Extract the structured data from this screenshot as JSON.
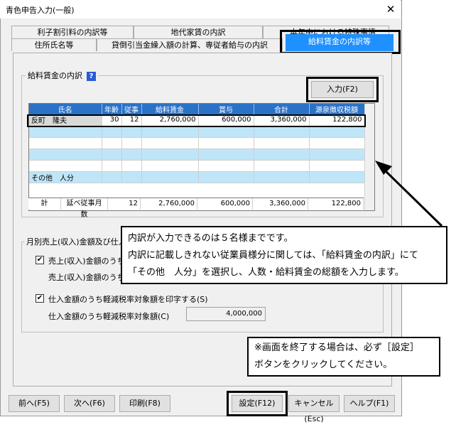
{
  "window": {
    "title": "青色申告入力(一般)",
    "close_glyph": "✕"
  },
  "tabs_row1": [
    {
      "label": "利子割引料の内訳等"
    },
    {
      "label": "地代家賃の内訳"
    },
    {
      "label": "本年中における特殊事情"
    }
  ],
  "tabs_row2": [
    {
      "label": "住所氏名等"
    },
    {
      "label": "貸倒引当金繰入額の計算、専従者給与の内訳"
    },
    {
      "label": "給料賃金の内訳等"
    }
  ],
  "wages_group": {
    "title": "給料賃金の内訳",
    "help_glyph": "?",
    "input_button": "入力(F2)"
  },
  "table": {
    "columns": [
      "氏名",
      "年齢",
      "従事",
      "給料賃金",
      "賞与",
      "合計",
      "源泉徴収税額"
    ],
    "rows": [
      [
        "反町　隆夫",
        "30",
        "12",
        "2,760,000",
        "600,000",
        "3,360,000",
        "122,800"
      ],
      [
        "",
        "",
        "",
        "",
        "",
        "",
        ""
      ],
      [
        "",
        "",
        "",
        "",
        "",
        "",
        ""
      ],
      [
        "",
        "",
        "",
        "",
        "",
        "",
        ""
      ],
      [
        "",
        "",
        "",
        "",
        "",
        "",
        ""
      ],
      [
        "その他　人分",
        "",
        "",
        "",
        "",
        "",
        ""
      ]
    ],
    "summary": {
      "label": "計",
      "months_label": "延べ従事月数",
      "months": "12",
      "wages": "2,760,000",
      "bonus": "600,000",
      "total": "3,360,000",
      "tax": "122,800"
    }
  },
  "monthly_group": {
    "title": "月別売上(収入)金額及び仕入",
    "sales_checkbox_label": "売上(収入)金額のうち軽",
    "sales_sub_label": "売上(収入)金額のうち軽",
    "purchase_checkbox_label": "仕入金額のうち軽減税率対象額を印字する(S)",
    "purchase_sub_label": "仕入金額のうち軽減税率対象額(C)",
    "purchase_value": "4,000,000",
    "check_glyph": "✔"
  },
  "callout_main": {
    "line1": "内訳が入力できるのは５名様までです。",
    "line2": "内訳に記載しきれない従業員様分に関しては、「給料賃金の内訳」にて",
    "line3": "「その他　人分」を選択し、人数・給料賃金の総額を入力します。"
  },
  "callout_bottom": {
    "line1": "※画面を終了する場合は、必ず［設定］",
    "line2": "ボタンをクリックしてください。"
  },
  "buttons": {
    "prev": "前へ(F5)",
    "next": "次へ(F6)",
    "print": "印刷(F8)",
    "settings": "設定(F12)",
    "cancel": "キャンセル(Esc)",
    "help": "ヘルプ(F1)"
  }
}
